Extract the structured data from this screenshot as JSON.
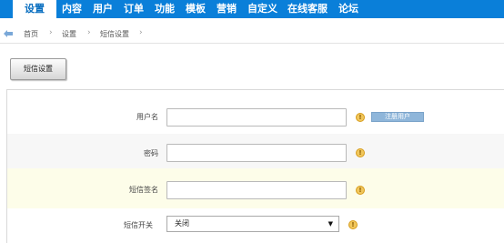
{
  "nav": {
    "items": [
      "设置",
      "内容",
      "用户",
      "订单",
      "功能",
      "模板",
      "营销",
      "自定义",
      "在线客服",
      "论坛"
    ]
  },
  "breadcrumb": {
    "items": [
      "首页",
      "设置",
      "短信设置"
    ]
  },
  "tab": {
    "label": "短信设置"
  },
  "form": {
    "username_label": "用户名",
    "password_label": "密码",
    "signature_label": "短信签名",
    "switch_label": "短信开关",
    "register_button": "注册用户",
    "switch_value": "关闭",
    "warn_glyph": "!"
  },
  "colors": {
    "nav_bg": "#0a7fd9",
    "row_highlight": "#fdfde9"
  }
}
